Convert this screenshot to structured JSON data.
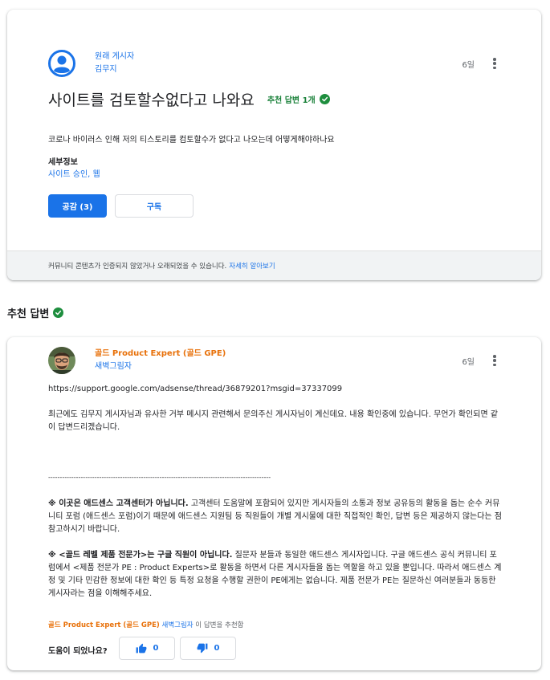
{
  "question": {
    "author_role": "원래 게시자",
    "author_name": "김무지",
    "date": "6일",
    "title": "사이트를 검토할수없다고 나와요",
    "recommended_badge": "추천 답변 1개",
    "body": "코로나 바이러스 인해 저의 티스토리를 컴토할수가 없다고 나오는데 어떻게해야하나요",
    "details_label": "세부정보",
    "details_value": "사이트 승인, 웹",
    "like_button": "공감 (3)",
    "subscribe_button": "구독",
    "notice_text": "커뮤니티 콘텐츠가 인증되지 않았거나 오래되었을 수 있습니다.",
    "notice_link": "자세히 알아보기"
  },
  "recommended_section": {
    "heading": "추천 답변"
  },
  "answer": {
    "author_role": "골드 Product Expert (골드 GPE)",
    "author_name": "새벽그림자",
    "date": "6일",
    "link": "https://support.google.com/adsense/thread/36879201?msgid=37337099",
    "paragraph1": "최근에도 김무지 게시자님과 유사한 거부 메시지 관련해서 문의주신 게시자님이 계신데요. 내용 확인중에 있습니다. 무언가 확인되면 같이 답변드리겠습니다.",
    "separator": "------------------------------------------------------------------------------------------------",
    "notice1_bold": "※ 이곳은 애드센스 고객센터가 아닙니다.",
    "notice1_text": " 고객센터 도움말에 포함되어 있지만 게시자들의 소통과 정보 공유등의 활동을 돕는 순수 커뮤니티 포럼 (애드센스 포럼)이기 때문에 애드센스 지원팀 등 직원들이 개별 게시물에 대한 직접적인 확인, 답변 등은 제공하지 않는다는 점 참고하시기 바랍니다.",
    "notice2_bold": "※ <골드 레벨 제품 전문가>는 구글 직원이 아닙니다.",
    "notice2_text": " 질문자 분들과 동일한 애드센스 게시자입니다. 구글 애드센스 공식 커뮤니티 포럼에서 <제품 전문가 PE : Product Experts>로 활동을 하면서 다른 게시자들을 돕는 역할을 하고 있을 뿐입니다. 따라서 애드센스 계정 및 기타 민감한 정보에 대한 확인 등 특정 요청을 수행할 권한이 PE에게는 없습니다. 제품 전문가 PE는 질문하신 여러분들과 동등한 게시자라는 점을 이해해주세요.",
    "rec_by_role": "골드 Product Expert (골드 GPE)",
    "rec_by_name": "새벽그림자",
    "rec_suffix": " 이 답변을 추천함",
    "helpful_label": "도움이 되었나요?",
    "upvotes": "0",
    "downvotes": "0"
  },
  "colors": {
    "primary_blue": "#1a73e8",
    "gpe_orange": "#e8710a",
    "check_green": "#1e8e3e"
  }
}
